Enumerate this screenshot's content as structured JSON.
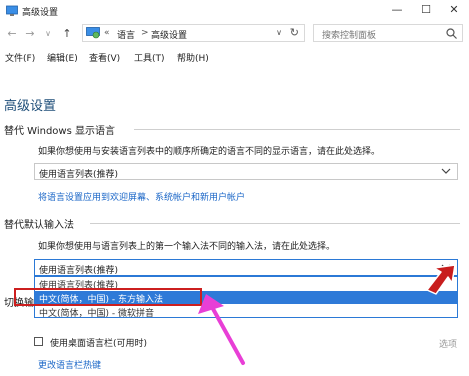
{
  "window": {
    "title": "高级设置",
    "controls": {
      "minimize": "—",
      "maximize": "☐",
      "close": "✕"
    }
  },
  "nav": {
    "back": "←",
    "forward": "→",
    "recent": "∨",
    "up": "↑",
    "breadcrumb": {
      "overflow": "«",
      "parent": "语言",
      "current": "高级设置"
    },
    "search_placeholder": "搜索控制面板"
  },
  "menu": [
    "文件(F)",
    "编辑(E)",
    "查看(V)",
    "工具(T)",
    "帮助(H)"
  ],
  "page_title": "高级设置",
  "display_language": {
    "heading": "替代 Windows 显示语言",
    "description": "如果你想使用与安装语言列表中的顺序所确定的语言不同的显示语言，请在此处选择。",
    "selected": "使用语言列表(推荐)",
    "link": "将语言设置应用到欢迎屏幕、系统帐户和新用户帐户"
  },
  "default_input": {
    "heading": "替代默认输入法",
    "description": "如果你想使用与语言列表上的第一个输入法不同的输入法，请在此处选择。",
    "selected": "使用语言列表(推荐)",
    "options": [
      "使用语言列表(推荐)",
      "中文(简体，中国) - 东方输入法",
      "中文(简体，中国) - 微软拼音"
    ],
    "selected_option_index": 1
  },
  "switching": {
    "heading_partial": "切换输",
    "checkbox_label": "使用桌面语言栏(可用时)",
    "checkbox_checked": false,
    "options_link": "选项",
    "hotkey_link": "更改语言栏热键"
  },
  "colors": {
    "accent": "#2e7ad8",
    "highlight_box": "#cc1f1f",
    "arrow": "#e83fd6",
    "link": "#1a66c7"
  }
}
